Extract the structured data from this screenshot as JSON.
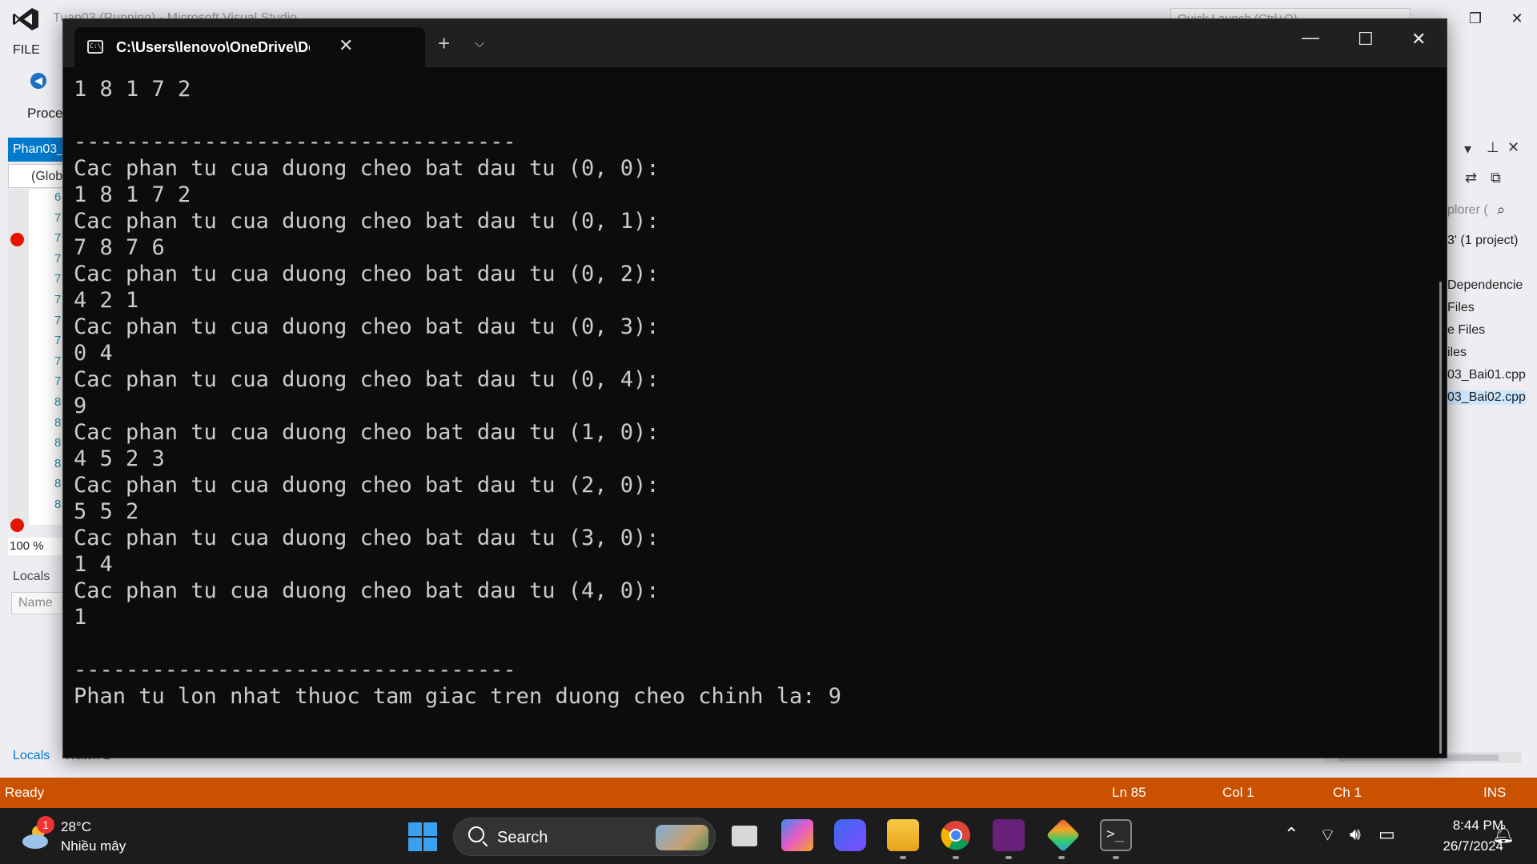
{
  "vs": {
    "title": "Tuan03 (Running) - Microsoft Visual Studio",
    "quick_launch": "Quick Launch (Ctrl+Q)",
    "menu_file": "FILE",
    "process_label": "Proce",
    "doc_tab": "Phan03_",
    "scope": "(Glob",
    "line_numbers": [
      "6",
      "7",
      "7",
      "7",
      "7",
      "7",
      "7",
      "7",
      "7",
      "7",
      "8",
      "8",
      "8",
      "8",
      "8",
      "8"
    ],
    "zoom": "100 %",
    "locals_title": "Locals",
    "locals_col_name": "Name",
    "bottom_tab_locals": "Locals",
    "bottom_tab_watch": "Watch 1",
    "solution_explorer": {
      "search_placeholder": "plorer (",
      "solution": "3' (1 project)",
      "items": [
        "Dependencie",
        "Files",
        "e Files",
        "iles",
        "03_Bai01.cpp",
        "03_Bai02.cpp"
      ]
    },
    "status": {
      "ready": "Ready",
      "ln": "Ln 85",
      "col": "Col 1",
      "ch": "Ch 1",
      "ins": "INS"
    }
  },
  "terminal": {
    "tab_title": "C:\\Users\\lenovo\\OneDrive\\De",
    "output": [
      "1 8 1 7 2",
      "",
      "----------------------------------",
      "Cac phan tu cua duong cheo bat dau tu (0, 0):",
      "1 8 1 7 2",
      "Cac phan tu cua duong cheo bat dau tu (0, 1):",
      "7 8 7 6",
      "Cac phan tu cua duong cheo bat dau tu (0, 2):",
      "4 2 1",
      "Cac phan tu cua duong cheo bat dau tu (0, 3):",
      "0 4",
      "Cac phan tu cua duong cheo bat dau tu (0, 4):",
      "9",
      "Cac phan tu cua duong cheo bat dau tu (1, 0):",
      "4 5 2 3",
      "Cac phan tu cua duong cheo bat dau tu (2, 0):",
      "5 5 2",
      "Cac phan tu cua duong cheo bat dau tu (3, 0):",
      "1 4",
      "Cac phan tu cua duong cheo bat dau tu (4, 0):",
      "1",
      "",
      "----------------------------------",
      "Phan tu lon nhat thuoc tam giac tren duong cheo chinh la: 9"
    ]
  },
  "taskbar": {
    "weather_badge": "1",
    "temperature": "28°C",
    "weather_desc": "Nhiều mây",
    "search_label": "Search",
    "apps": [
      "task-view",
      "copilot",
      "copilot-app",
      "file-explorer",
      "chrome",
      "visual-studio",
      "git-app",
      "terminal"
    ],
    "time": "8:44 PM",
    "date": "26/7/2024"
  },
  "colors": {
    "vs_accent": "#007acc",
    "status_bar": "#ca5100",
    "terminal_bg": "#0c0c0c",
    "terminal_text": "#cccccc",
    "taskbar_bg": "#1c1c1c"
  }
}
